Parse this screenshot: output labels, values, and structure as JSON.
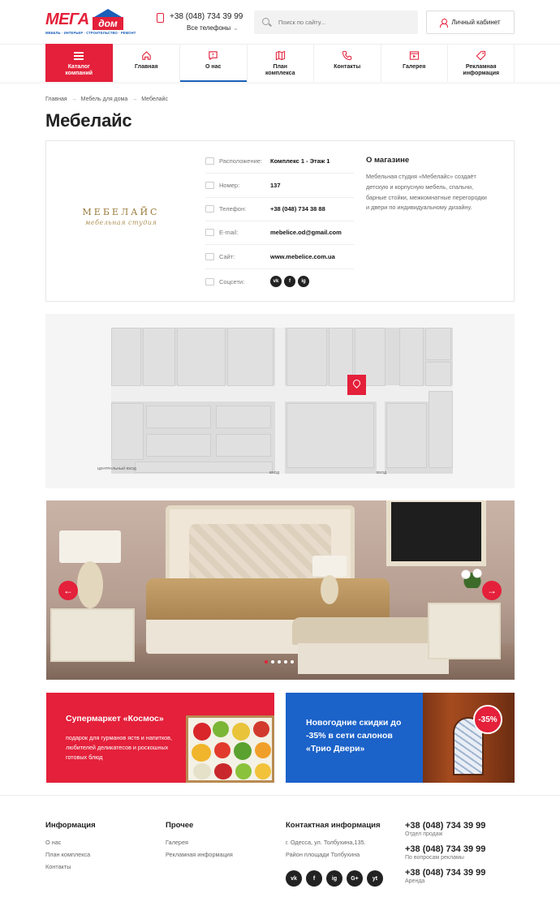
{
  "header": {
    "logo_main": "МЕГА",
    "logo_accent": "дом",
    "logo_tagline": "МЕБЕЛЬ · ИНТЕРЬЕР · СТРОИТЕЛЬСТВО · РЕМОНТ",
    "phone": "+38 (048) 734 39 99",
    "all_phones": "Все телефоны",
    "search_placeholder": "Поиск по сайту...",
    "cabinet": "Личный кабинет"
  },
  "nav": {
    "catalog": "Каталог компаний",
    "items": [
      {
        "label": "Главная",
        "icon": "home-icon"
      },
      {
        "label": "О нас",
        "icon": "chat-icon"
      },
      {
        "label": "План комплекса",
        "icon": "map-icon"
      },
      {
        "label": "Контакты",
        "icon": "phone-icon"
      },
      {
        "label": "Галерея",
        "icon": "gallery-icon"
      },
      {
        "label": "Рекламная информация",
        "icon": "tag-icon"
      }
    ],
    "active": "О нас"
  },
  "breadcrumbs": [
    "Главная",
    "Мебель для дома",
    "Мебелайс"
  ],
  "page_title": "Мебелайс",
  "store": {
    "brand_name": "МЕБЕЛАЙС",
    "brand_sub": "мебельная студия",
    "rows": [
      {
        "label": "Расположение:",
        "value": "Комплекс 1 - Этаж 1",
        "icon": "location-icon"
      },
      {
        "label": "Номер:",
        "value": "137",
        "icon": "hash-icon"
      },
      {
        "label": "Телефон:",
        "value": "+38 (048) 734 38 88",
        "icon": "phone-icon"
      },
      {
        "label": "E-mail:",
        "value": "mebelice.od@gmail.com",
        "icon": "mail-icon"
      },
      {
        "label": "Сайт:",
        "value": "www.mebelice.com.ua",
        "icon": "browser-icon"
      },
      {
        "label": "Соцсети:",
        "value": "",
        "icon": "social-icon"
      }
    ],
    "socials": [
      "vk",
      "f",
      "ig"
    ],
    "about_title": "О магазине",
    "about_text": "Мебельная студия «Мебелайс» создаёт детскую и корпусную мебель, спальни, барные стойки, межкомнатные перегородки и двери по индивидуальному  дизайну."
  },
  "map": {
    "labels": [
      "ЦЕНТРАЛЬНЫЙ ВХОД",
      "ВХОД",
      "ВХОД"
    ]
  },
  "slider": {
    "prev": "←",
    "next": "→",
    "slides": 5,
    "active_slide": 1
  },
  "promos": [
    {
      "title": "Супермаркет «Космос»",
      "text": "подарок для гурманов яств и напитков, любителей деликатесов и роскошных готовых блюд"
    },
    {
      "title": "Новогодние скидки до -35% в сети салонов «Трио Двери»",
      "badge": "-35%"
    }
  ],
  "footer": {
    "info_title": "Информация",
    "info_links": [
      "О нас",
      "План комплекса",
      "Контакты"
    ],
    "other_title": "Прочее",
    "other_links": [
      "Галерея",
      "Рекламная информация"
    ],
    "contact_title": "Контактная информация",
    "address1": "г. Одесса, ул. Толбухина,135.",
    "address2": "Район площади Толбухина",
    "socials": [
      "vk",
      "f",
      "ig",
      "G+",
      "yt"
    ],
    "phones": [
      {
        "number": "+38 (048) 734 39 99",
        "note": "Отдел продаж"
      },
      {
        "number": "+38 (048) 734 39 99",
        "note": "По вопросам рекламы"
      },
      {
        "number": "+38 (048) 734 39 99",
        "note": "Аренда"
      }
    ]
  },
  "colors": {
    "brand_red": "#e4203a",
    "brand_blue": "#1b62c9"
  }
}
